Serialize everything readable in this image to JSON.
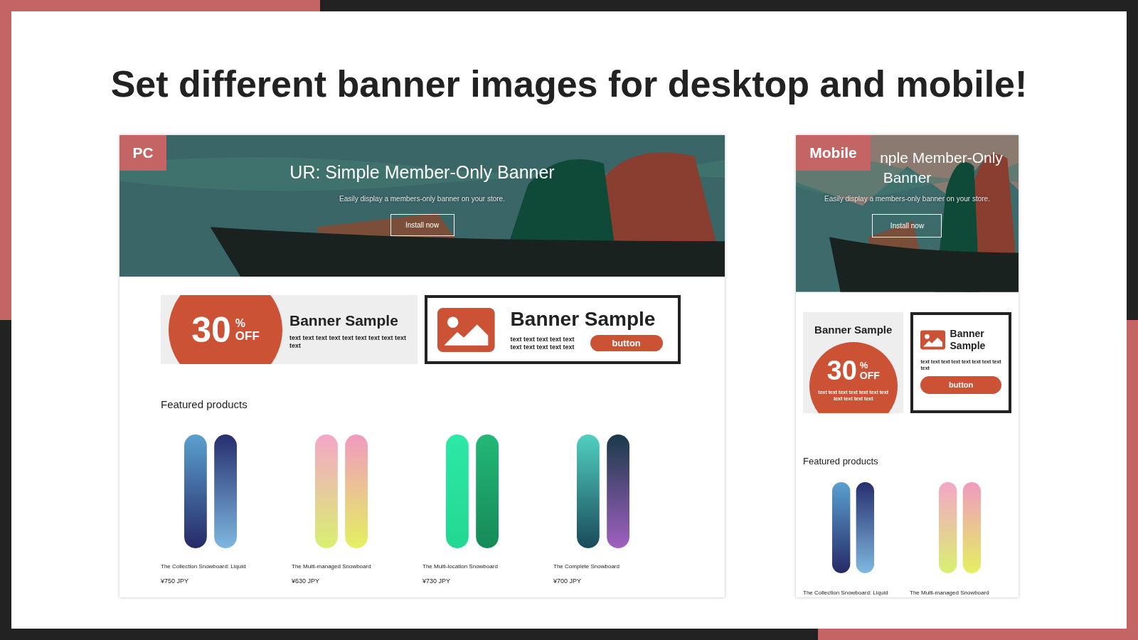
{
  "headline": "Set different banner images for desktop and mobile!",
  "previews": [
    {
      "kind": "desktop",
      "label": "PC",
      "hero": {
        "title_lines": [
          "UR: Simple Member-Only Banner"
        ],
        "subtitle": "Easily display a members-only banner on your store.",
        "button": "Install now"
      },
      "banners": [
        {
          "kind": "discount",
          "number": "30",
          "percent": "%",
          "off": "OFF",
          "title": "Banner Sample",
          "text": "text text text text text text text text text text"
        },
        {
          "kind": "image",
          "title": "Banner Sample",
          "text": "text text text text text text text text text text",
          "button": "button"
        }
      ],
      "featured_heading": "Featured products",
      "products": [
        {
          "name": "The Collection Snowboard: Liquid",
          "price": "¥750 JPY"
        },
        {
          "name": "The Multi-managed Snowboard",
          "price": "¥630 JPY"
        },
        {
          "name": "The Multi-location Snowboard",
          "price": "¥730 JPY"
        },
        {
          "name": "The Complete Snowboard",
          "price": "¥700 JPY"
        }
      ]
    },
    {
      "kind": "mobile",
      "label": "Mobile",
      "hero": {
        "title_lines": [
          "nple Member-Only",
          "Banner"
        ],
        "subtitle": "Easily display a members-only banner on your store.",
        "button": "Install now"
      },
      "banners": [
        {
          "kind": "discount",
          "number": "30",
          "percent": "%",
          "off": "OFF",
          "title": "Banner Sample",
          "text": "text text text text text text text text text text text"
        },
        {
          "kind": "image",
          "title": "Banner Sample",
          "text": "text text text text text text text text text",
          "button": "button"
        }
      ],
      "featured_heading": "Featured products",
      "products": [
        {
          "name": "The Collection Snowboard: Liquid"
        },
        {
          "name": "The Multi-managed Snowboard"
        }
      ]
    }
  ]
}
